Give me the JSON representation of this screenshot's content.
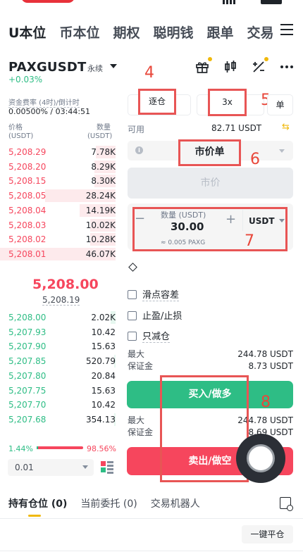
{
  "nav": {
    "tabs": [
      {
        "label": "U本位",
        "active": true
      },
      {
        "label": "币本位"
      },
      {
        "label": "期权"
      },
      {
        "label": "聪明钱"
      },
      {
        "label": "跟单"
      },
      {
        "label": "交易"
      }
    ]
  },
  "symbol": {
    "name": "PAXGUSDT",
    "type": "永续",
    "change": "+0.03%"
  },
  "funding": {
    "label": "资金费率 (4时)/倒计时",
    "value": "0.00500% / 03:44:51"
  },
  "orderbook": {
    "price_header": "价格",
    "price_unit": "(USDT)",
    "qty_header": "数量",
    "qty_unit": "(USDT)",
    "asks": [
      {
        "price": "5,208.29",
        "qty": "7.78K",
        "depth": 0.17
      },
      {
        "price": "5,208.20",
        "qty": "8.29K",
        "depth": 0.18
      },
      {
        "price": "5,208.15",
        "qty": "8.30K",
        "depth": 0.18
      },
      {
        "price": "5,208.05",
        "qty": "28.24K",
        "depth": 0.61
      },
      {
        "price": "5,208.04",
        "qty": "14.19K",
        "depth": 0.31
      },
      {
        "price": "5,208.03",
        "qty": "10.02K",
        "depth": 0.22
      },
      {
        "price": "5,208.02",
        "qty": "10.28K",
        "depth": 0.22
      },
      {
        "price": "5,208.01",
        "qty": "46.07K",
        "depth": 1.0
      }
    ],
    "mid_price": "5,208.00",
    "mark_price": "5,208.19",
    "bids": [
      {
        "price": "5,208.00",
        "qty": "2.02K",
        "depth": 0.04
      },
      {
        "price": "5,207.93",
        "qty": "10.42",
        "depth": 0.0
      },
      {
        "price": "5,207.90",
        "qty": "15.63",
        "depth": 0.0
      },
      {
        "price": "5,207.85",
        "qty": "520.79",
        "depth": 0.01
      },
      {
        "price": "5,207.80",
        "qty": "20.84",
        "depth": 0.0
      },
      {
        "price": "5,207.75",
        "qty": "15.63",
        "depth": 0.0
      },
      {
        "price": "5,207.70",
        "qty": "10.42",
        "depth": 0.0
      },
      {
        "price": "5,207.68",
        "qty": "354.13",
        "depth": 0.01
      }
    ],
    "buy_ratio": "1.44%",
    "sell_ratio": "98.56%",
    "buy_ratio_value": 0.0144,
    "tick_size": "0.01"
  },
  "form": {
    "margin_mode": "逐仓",
    "leverage": "3x",
    "position_mode": "单",
    "available_label": "可用",
    "available_value": "82.71 USDT",
    "order_type": "市价单",
    "price_placeholder": "市价",
    "qty_label": "数量 (USDT)",
    "qty_value": "30.00",
    "qty_unit": "USDT",
    "qty_converted": "≈ 0.005 PAXG",
    "minus": "−",
    "plus": "+",
    "options": [
      "滑点容差",
      "止盈/止损",
      "只减仓"
    ],
    "buy_max_label": "最大",
    "buy_max_value": "244.78 USDT",
    "buy_margin_label": "保证金",
    "buy_margin_value": "8.73 USDT",
    "buy_button": "买入/做多",
    "sell_max_label": "最大",
    "sell_max_value": "244.78 USDT",
    "sell_margin_label": "保证金",
    "sell_margin_value": "8.69 USDT",
    "sell_button": "卖出/做空"
  },
  "annotations": [
    "4",
    "5",
    "6",
    "7",
    "8"
  ],
  "bottom": {
    "tabs": [
      {
        "label": "持有仓位 (0)",
        "active": true
      },
      {
        "label": "当前委托 (0)"
      },
      {
        "label": "交易机器人"
      }
    ],
    "close_all": "一键平仓"
  },
  "colors": {
    "buy": "#2ebd85",
    "sell": "#f6465d",
    "accent": "#f0b90b",
    "annotation": "#e85555"
  }
}
